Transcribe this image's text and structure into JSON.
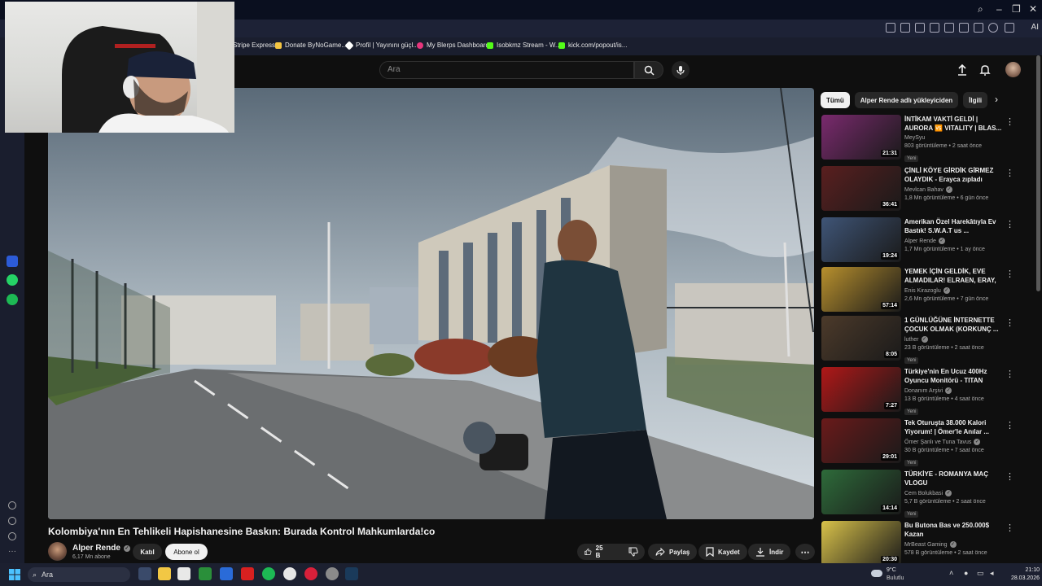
{
  "browser": {
    "ai_label": "AI",
    "bookmarks": [
      {
        "label": "Stripe Express",
        "color": "#635bff"
      },
      {
        "label": "Donate ByNoGame...",
        "color": "#f5c542"
      },
      {
        "label": "Profil | Yayınını güçl...",
        "color": "#ffffff"
      },
      {
        "label": "My Blerps Dashboard",
        "color": "#e6357c"
      },
      {
        "label": "Isobkmz Stream - W...",
        "color": "#53fc18"
      },
      {
        "label": "kick.com/popout/is...",
        "color": "#53fc18"
      }
    ]
  },
  "youtube": {
    "search_placeholder": "Ara",
    "video": {
      "title": "Kolombiya'nın En Tehlikeli Hapishanesine Baskın: Burada Kontrol Mahkumlarda!co",
      "channel": "Alper Rende",
      "subscribers": "6,17 Mn abone",
      "join_label": "Katıl",
      "subscribe_label": "Abone ol",
      "likes": "25 B",
      "share_label": "Paylaş",
      "save_label": "Kaydet",
      "download_label": "İndir"
    },
    "chips": [
      "Tümü",
      "Alper Rende adlı yükleyiciden",
      "İlgili"
    ],
    "recommendations": [
      {
        "title": "İNTİKAM VAKTİ GELDİ | AURORA 🆚 VITALITY | BLAS...",
        "channel": "MeySyu",
        "verified": false,
        "meta": "803 görüntüleme • 2 saat önce",
        "badge": "Yeni",
        "duration": "21:31",
        "thumb_color": "#7a2a6e"
      },
      {
        "title": "ÇİNLİ KÖYE GİRDİK GİRMEZ OLAYDIK - Erayca zıpladı",
        "channel": "Mevlcan Bahav",
        "verified": true,
        "meta": "1,8 Mn görüntüleme • 6 gün önce",
        "badge": "",
        "duration": "36:41",
        "thumb_color": "#5a1f1f"
      },
      {
        "title": "Amerikan Özel Harekâtıyla Ev Bastık! S.W.A.T us ...",
        "channel": "Alper Rende",
        "verified": true,
        "meta": "1,7 Mn görüntüleme • 1 ay önce",
        "badge": "",
        "duration": "19:24",
        "thumb_color": "#3f5577"
      },
      {
        "title": "YEMEK İÇİN GELDİK, EVE ALMADILAR! ELRAEN, ERAY, ...",
        "channel": "Enis Kirazoglu",
        "verified": true,
        "meta": "2,6 Mn görüntüleme • 7 gün önce",
        "badge": "",
        "duration": "57:14",
        "thumb_color": "#b8902d"
      },
      {
        "title": "1 GÜNLÜĞÜNE İNTERNETTE ÇOCUK OLMAK (KORKUNÇ ...",
        "channel": "luther",
        "verified": true,
        "meta": "23 B görüntüleme • 2 saat önce",
        "badge": "Yeni",
        "duration": "8:05",
        "thumb_color": "#4c3a2a"
      },
      {
        "title": "Türkiye'nin En Ucuz 400Hz Oyuncu Monitörü - TITAN",
        "channel": "Donanım Arşivi",
        "verified": true,
        "meta": "13 B görüntüleme • 4 saat önce",
        "badge": "Yeni",
        "duration": "7:27",
        "thumb_color": "#b01818"
      },
      {
        "title": "Tek Oturuşta 38.000 Kalori Yiyorum! | Ömer'le Anılar ...",
        "channel": "Ömer Şanlı ve Tuna Tavus",
        "verified": true,
        "meta": "30 B görüntüleme • 7 saat önce",
        "badge": "Yeni",
        "duration": "29:01",
        "thumb_color": "#6a1a1a"
      },
      {
        "title": "TÜRKİYE - ROMANYA MAÇ VLOGU",
        "channel": "Cem Bolukbasi",
        "verified": true,
        "meta": "5,7 B görüntüleme • 2 saat önce",
        "badge": "Yeni",
        "duration": "14:14",
        "thumb_color": "#2e6b3a"
      },
      {
        "title": "Bu Butona Bas ve 250.000$ Kazan",
        "channel": "MrBeast Gaming",
        "verified": true,
        "meta": "578 B görüntüleme • 2 saat önce",
        "badge": "",
        "duration": "20:30",
        "thumb_color": "#d9c24a"
      }
    ]
  },
  "taskbar": {
    "search_placeholder": "Ara",
    "weather_temp": "9°C",
    "weather_desc": "Bulutlu",
    "time": "21:10",
    "date": "28.03.2026"
  }
}
